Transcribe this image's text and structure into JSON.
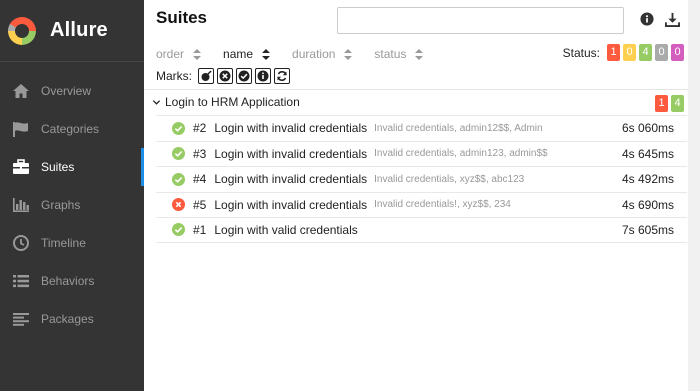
{
  "brand": {
    "name": "Allure"
  },
  "nav": [
    {
      "label": "Overview",
      "icon": "home-icon"
    },
    {
      "label": "Categories",
      "icon": "flag-icon"
    },
    {
      "label": "Suites",
      "icon": "briefcase-icon",
      "active": true
    },
    {
      "label": "Graphs",
      "icon": "bar-chart-icon"
    },
    {
      "label": "Timeline",
      "icon": "clock-icon"
    },
    {
      "label": "Behaviors",
      "icon": "list-icon"
    },
    {
      "label": "Packages",
      "icon": "align-left-icon"
    }
  ],
  "header": {
    "title": "Suites",
    "search_value": "",
    "search_placeholder": ""
  },
  "sort": {
    "order": "order",
    "name": "name",
    "duration": "duration",
    "status": "status",
    "active": "name"
  },
  "status_filter": {
    "label": "Status:",
    "pills": [
      {
        "value": "1",
        "color": "#fd5a3e"
      },
      {
        "value": "0",
        "color": "#ffd050"
      },
      {
        "value": "4",
        "color": "#97cc64"
      },
      {
        "value": "0",
        "color": "#aaaaaa"
      },
      {
        "value": "0",
        "color": "#d35ebe"
      }
    ]
  },
  "marks": {
    "label": "Marks:",
    "items": [
      "bomb-icon",
      "times-circle-icon",
      "check-circle-icon",
      "info-circle-icon",
      "refresh-icon"
    ]
  },
  "group": {
    "label": "Login to HRM Application",
    "pills": [
      {
        "value": "1",
        "color": "#fd5a3e"
      },
      {
        "value": "4",
        "color": "#97cc64"
      }
    ]
  },
  "tests": [
    {
      "status": "passed",
      "num": "#2",
      "name": "Login with invalid credentials",
      "params": "Invalid credentials, admin12$$, Admin",
      "duration": "6s 060ms"
    },
    {
      "status": "passed",
      "num": "#3",
      "name": "Login with invalid credentials",
      "params": "Invalid credentials, admin123, admin$$",
      "duration": "4s 645ms"
    },
    {
      "status": "passed",
      "num": "#4",
      "name": "Login with invalid credentials",
      "params": "Invalid credentials, xyz$$, abc123",
      "duration": "4s 492ms"
    },
    {
      "status": "failed",
      "num": "#5",
      "name": "Login with invalid credentials",
      "params": "Invalid credentials!, xyz$$, 234",
      "duration": "4s 690ms"
    },
    {
      "status": "passed",
      "num": "#1",
      "name": "Login with valid credentials",
      "params": "",
      "duration": "7s 605ms"
    }
  ],
  "colors": {
    "passed": "#97cc64",
    "failed": "#fd5a3e",
    "accent": "#1d8ee8",
    "sidebar": "#343434"
  }
}
